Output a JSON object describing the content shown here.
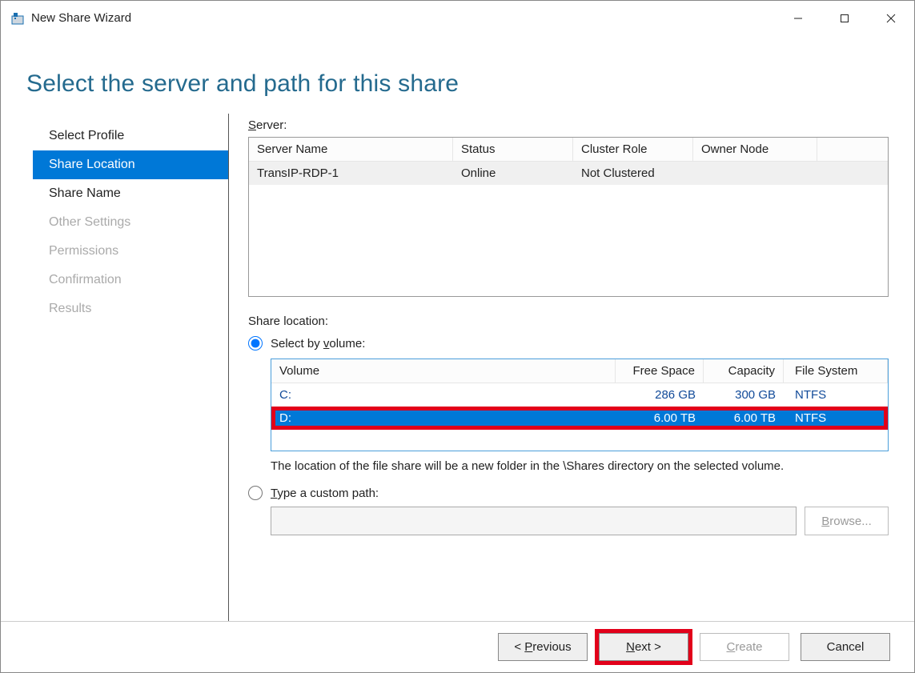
{
  "window": {
    "title": "New Share Wizard"
  },
  "header": {
    "title": "Select the server and path for this share"
  },
  "sidebar": {
    "items": [
      {
        "label": "Select Profile",
        "state": "normal"
      },
      {
        "label": "Share Location",
        "state": "active"
      },
      {
        "label": "Share Name",
        "state": "normal"
      },
      {
        "label": "Other Settings",
        "state": "disabled"
      },
      {
        "label": "Permissions",
        "state": "disabled"
      },
      {
        "label": "Confirmation",
        "state": "disabled"
      },
      {
        "label": "Results",
        "state": "disabled"
      }
    ]
  },
  "server_section": {
    "label": "Server:",
    "columns": {
      "server_name": "Server Name",
      "status": "Status",
      "cluster_role": "Cluster Role",
      "owner_node": "Owner Node"
    },
    "rows": [
      {
        "server_name": "TransIP-RDP-1",
        "status": "Online",
        "cluster_role": "Not Clustered",
        "owner_node": ""
      }
    ]
  },
  "share_location": {
    "label": "Share location:",
    "radio_volume_label": "Select by volume:",
    "volume_columns": {
      "volume": "Volume",
      "free_space": "Free Space",
      "capacity": "Capacity",
      "file_system": "File System"
    },
    "volumes": [
      {
        "volume": "C:",
        "free_space": "286 GB",
        "capacity": "300 GB",
        "file_system": "NTFS",
        "selected": false
      },
      {
        "volume": "D:",
        "free_space": "6.00 TB",
        "capacity": "6.00 TB",
        "file_system": "NTFS",
        "selected": true
      }
    ],
    "help_text": "The location of the file share will be a new folder in the \\Shares directory on the selected volume.",
    "radio_custom_label": "Type a custom path:",
    "custom_path_value": "",
    "browse_label": "Browse..."
  },
  "footer": {
    "previous": "< Previous",
    "next": "Next >",
    "create": "Create",
    "cancel": "Cancel"
  }
}
